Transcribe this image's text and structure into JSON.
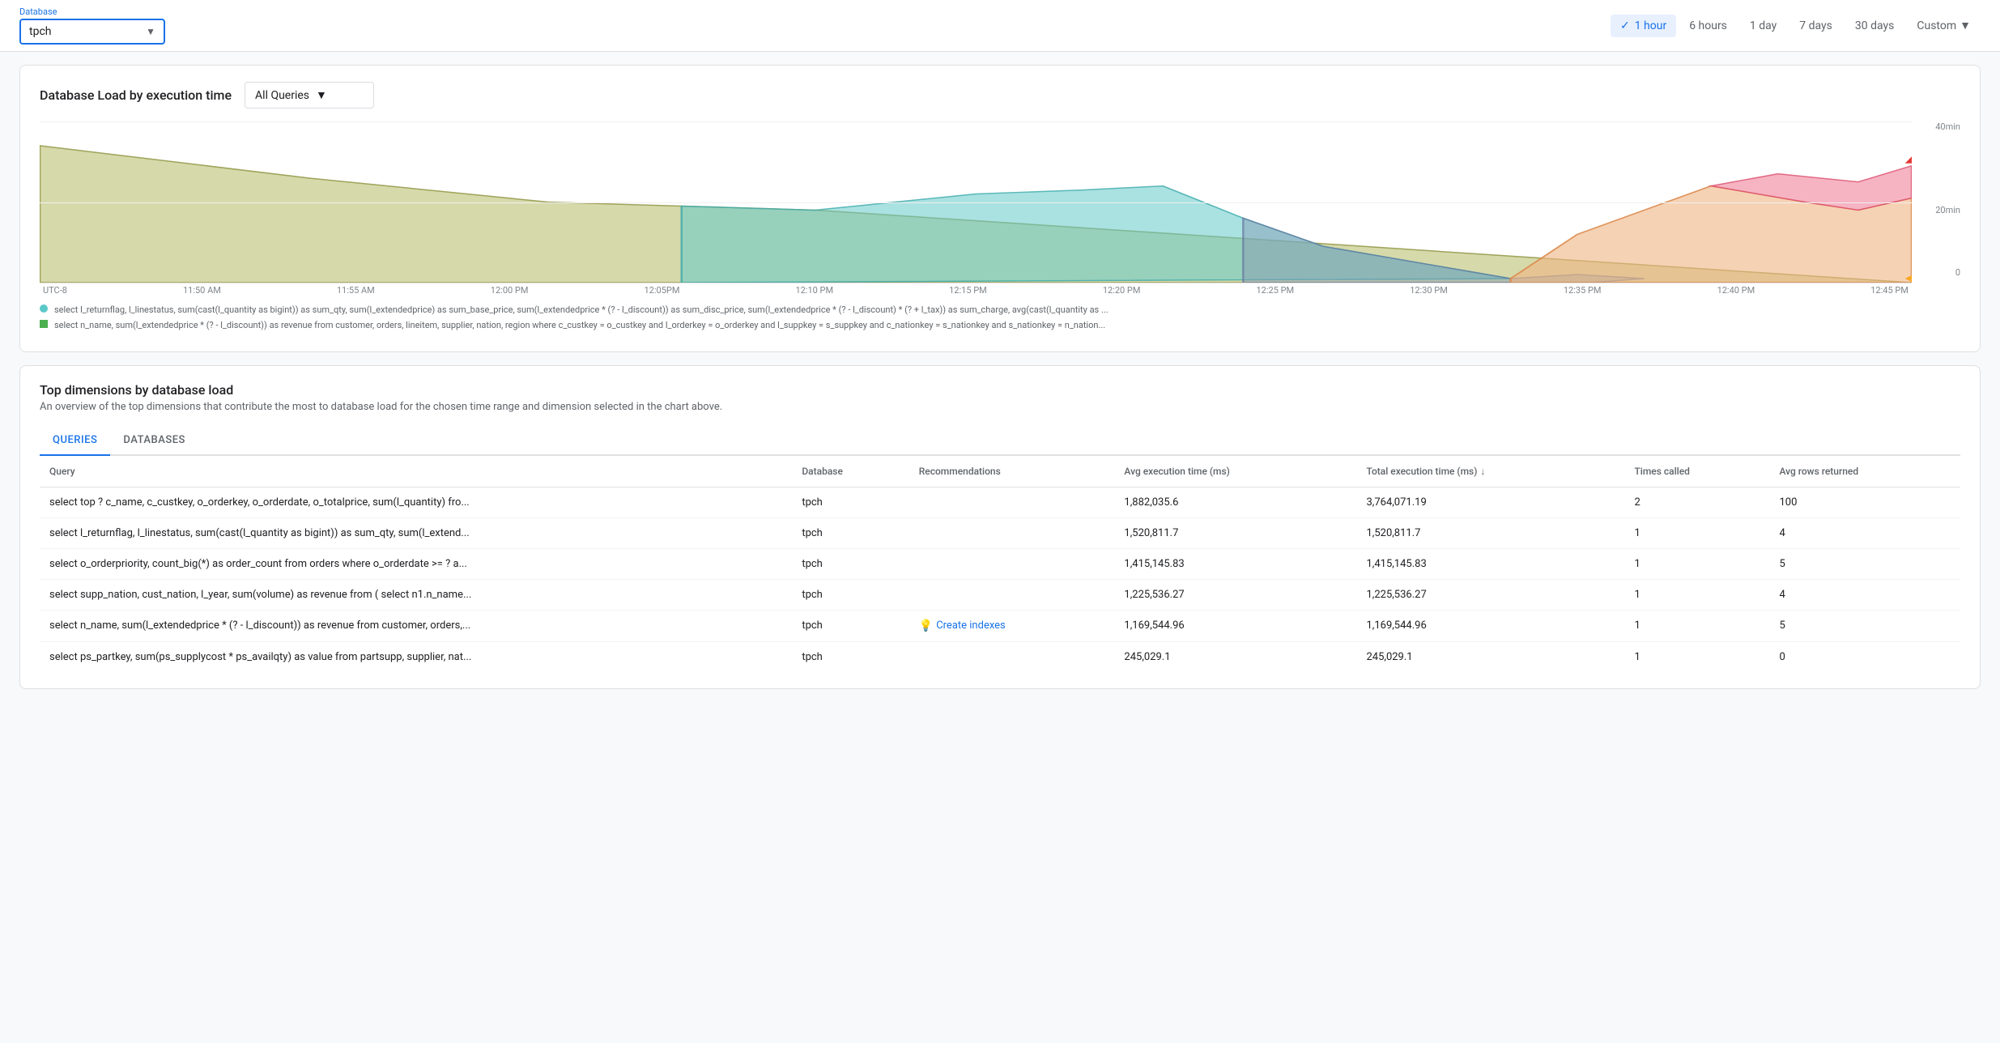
{
  "header": {
    "db_label": "Database",
    "db_value": "tpch",
    "time_options": [
      {
        "id": "1hour",
        "label": "1 hour",
        "active": true,
        "has_check": true
      },
      {
        "id": "6hours",
        "label": "6 hours",
        "active": false
      },
      {
        "id": "1day",
        "label": "1 day",
        "active": false
      },
      {
        "id": "7days",
        "label": "7 days",
        "active": false
      },
      {
        "id": "30days",
        "label": "30 days",
        "active": false
      },
      {
        "id": "custom",
        "label": "Custom",
        "active": false,
        "has_arrow": true
      }
    ]
  },
  "chart_section": {
    "title": "Database Load by execution time",
    "filter_label": "All Queries",
    "y_top": "40min",
    "y_mid": "20min",
    "y_zero": "0",
    "x_labels": [
      "UTC-8",
      "11:50 AM",
      "11:55 AM",
      "12:00 PM",
      "12:05PM",
      "12:10 PM",
      "12:15 PM",
      "12:20 PM",
      "12:25 PM",
      "12:30 PM",
      "12:35 PM",
      "12:40 PM",
      "12:45 PM"
    ],
    "legend": [
      {
        "type": "dot",
        "color": "#7ec8c8",
        "text": "select l_returnflag, l_linestatus, sum(cast(l_quantity as bigint)) as sum_qty, sum(l_extendedprice) as sum_base_price, sum(l_extendedprice * (? - l_discount)) as sum_disc_price, sum(l_extendedprice * (? - l_discount) * (? + l_tax)) as sum_charge, avg(cast(l_quantity as ..."
      },
      {
        "type": "square",
        "color": "#4caf50",
        "text": "select n_name, sum(l_extendedprice * (? - l_discount)) as revenue from customer, orders, lineitem, supplier, nation, region where c_custkey = o_custkey and l_orderkey = o_orderkey and l_suppkey = s_suppkey and c_nationkey = s_nationkey and s_nationkey = n_nation..."
      }
    ]
  },
  "bottom_section": {
    "title": "Top dimensions by database load",
    "subtitle": "An overview of the top dimensions that contribute the most to database load for the chosen time range and dimension selected in the chart above.",
    "tabs": [
      {
        "id": "queries",
        "label": "QUERIES",
        "active": true
      },
      {
        "id": "databases",
        "label": "DATABASES",
        "active": false
      }
    ],
    "table": {
      "columns": [
        {
          "id": "query",
          "label": "Query"
        },
        {
          "id": "database",
          "label": "Database"
        },
        {
          "id": "recommendations",
          "label": "Recommendations"
        },
        {
          "id": "avg_exec",
          "label": "Avg execution time (ms)"
        },
        {
          "id": "total_exec",
          "label": "Total execution time (ms)",
          "sorted": true
        },
        {
          "id": "times_called",
          "label": "Times called"
        },
        {
          "id": "avg_rows",
          "label": "Avg rows returned"
        }
      ],
      "rows": [
        {
          "query": "select top ? c_name, c_custkey, o_orderkey, o_orderdate, o_totalprice, sum(l_quantity) fro...",
          "database": "tpch",
          "recommendations": "",
          "avg_exec": "1,882,035.6",
          "total_exec": "3,764,071.19",
          "times_called": "2",
          "avg_rows": "100"
        },
        {
          "query": "select l_returnflag, l_linestatus, sum(cast(l_quantity as bigint)) as sum_qty, sum(l_extend...",
          "database": "tpch",
          "recommendations": "",
          "avg_exec": "1,520,811.7",
          "total_exec": "1,520,811.7",
          "times_called": "1",
          "avg_rows": "4"
        },
        {
          "query": "select o_orderpriority, count_big(*) as order_count from orders where o_orderdate >= ? a...",
          "database": "tpch",
          "recommendations": "",
          "avg_exec": "1,415,145.83",
          "total_exec": "1,415,145.83",
          "times_called": "1",
          "avg_rows": "5"
        },
        {
          "query": "select supp_nation, cust_nation, l_year, sum(volume) as revenue from ( select n1.n_name...",
          "database": "tpch",
          "recommendations": "",
          "avg_exec": "1,225,536.27",
          "total_exec": "1,225,536.27",
          "times_called": "1",
          "avg_rows": "4"
        },
        {
          "query": "select n_name, sum(l_extendedprice * (? - l_discount)) as revenue from customer, orders,...",
          "database": "tpch",
          "recommendations": "create_indexes",
          "avg_exec": "1,169,544.96",
          "total_exec": "1,169,544.96",
          "times_called": "1",
          "avg_rows": "5"
        },
        {
          "query": "select ps_partkey, sum(ps_supplycost * ps_availqty) as value from partsupp, supplier, nat...",
          "database": "tpch",
          "recommendations": "",
          "avg_exec": "245,029.1",
          "total_exec": "245,029.1",
          "times_called": "1",
          "avg_rows": "0"
        }
      ]
    }
  }
}
